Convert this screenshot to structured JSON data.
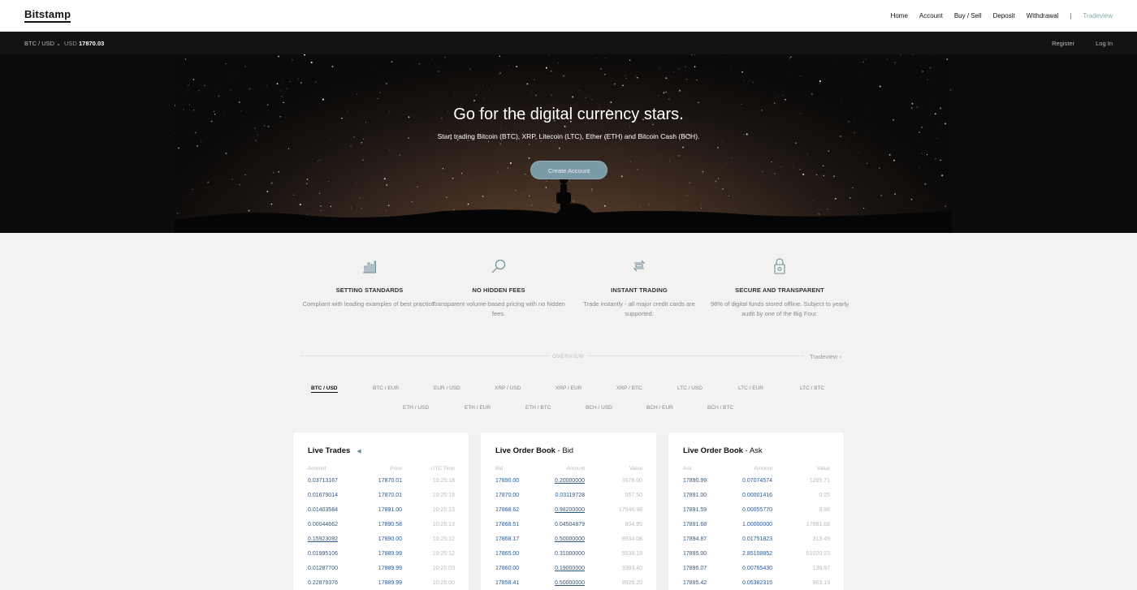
{
  "nav": {
    "logo": "Bitstamp",
    "items": [
      "Home",
      "Account",
      "Buy / Sell",
      "Deposit",
      "Withdrawal"
    ],
    "separator": "|",
    "tradeview": "Tradeview"
  },
  "ticker": {
    "pair": "BTC / USD",
    "currency": "USD",
    "price": "17870.03",
    "register": "Register",
    "login": "Log In"
  },
  "hero": {
    "title": "Go for the digital currency stars.",
    "subtitle": "Start trading Bitcoin (BTC), XRP, Litecoin (LTC), Ether (ETH) and Bitcoin Cash (BCH).",
    "cta": "Create Account"
  },
  "features": [
    {
      "icon": "bar-chart-icon",
      "title": "SETTING STANDARDS",
      "desc": "Compliant with leading examples of best practice."
    },
    {
      "icon": "magnifier-icon",
      "title": "NO HIDDEN FEES",
      "desc": "Transparent volume-based pricing with no hidden fees."
    },
    {
      "icon": "exchange-icon",
      "title": "INSTANT TRADING",
      "desc": "Trade instantly - all major credit cards are supported."
    },
    {
      "icon": "lock-icon",
      "title": "SECURE AND TRANSPARENT",
      "desc": "98% of digital funds stored offline. Subject to yearly audit by one of the Big Four."
    }
  ],
  "overview": {
    "label": "OVERVIEW",
    "tradeview_link": "Tradeview ›",
    "pairs_row1": [
      "BTC / USD",
      "BTC / EUR",
      "EUR / USD",
      "XRP / USD",
      "XRP / EUR",
      "XRP / BTC",
      "LTC / USD",
      "LTC / EUR",
      "LTC / BTC"
    ],
    "pairs_row2": [
      "ETH / USD",
      "ETH / EUR",
      "ETH / BTC",
      "BCH / USD",
      "BCH / EUR",
      "BCH / BTC"
    ],
    "active_pair": "BTC / USD"
  },
  "live_trades": {
    "title": "Live Trades",
    "headers": [
      "Amount",
      "Price",
      "UTC Time"
    ],
    "rows": [
      [
        "0.03713167",
        "17870.01",
        "10:25:18"
      ],
      [
        "0.01679014",
        "17870.01",
        "10:25:18"
      ],
      [
        "0.01403584",
        "17891.00",
        "10:25:13"
      ],
      [
        "0.00044662",
        "17890.58",
        "10:25:13"
      ],
      [
        "0.15923092",
        "17890.00",
        "10:25:12"
      ],
      [
        "0.01995106",
        "17889.99",
        "10:25:12"
      ],
      [
        "0.01287700",
        "17889.99",
        "10:25:03"
      ],
      [
        "0.22879376",
        "17889.99",
        "10:25:00"
      ]
    ],
    "underlined_rows": [
      4
    ]
  },
  "bid_book": {
    "title_bold": "Live Order Book",
    "title_rest": " - Bid",
    "headers": [
      "Bid",
      "Amount",
      "Value"
    ],
    "rows": [
      [
        "17890.00",
        "0.20000000",
        "3578.00"
      ],
      [
        "17870.00",
        "0.03119728",
        "557.50"
      ],
      [
        "17868.62",
        "0.98200000",
        "17546.98"
      ],
      [
        "17868.51",
        "0.04504879",
        "804.95"
      ],
      [
        "17868.17",
        "0.50000000",
        "8934.08"
      ],
      [
        "17865.00",
        "0.31000000",
        "5538.15"
      ],
      [
        "17860.00",
        "0.19000000",
        "3393.40"
      ],
      [
        "17858.41",
        "0.50000000",
        "8929.20"
      ]
    ],
    "underlined_rows": [
      0,
      2,
      4,
      6,
      7
    ]
  },
  "ask_book": {
    "title_bold": "Live Order Book",
    "title_rest": " - Ask",
    "headers": [
      "Ask",
      "Amount",
      "Value"
    ],
    "rows": [
      [
        "17890.99",
        "0.07074574",
        "1265.71"
      ],
      [
        "17891.00",
        "0.00001416",
        "0.25"
      ],
      [
        "17891.59",
        "0.00055770",
        "9.98"
      ],
      [
        "17891.68",
        "1.00000000",
        "17891.68"
      ],
      [
        "17894.87",
        "0.01751823",
        "313.49"
      ],
      [
        "17895.00",
        "2.85108852",
        "51020.23"
      ],
      [
        "17895.07",
        "0.00765430",
        "136.97"
      ],
      [
        "17895.42",
        "0.05382315",
        "963.19"
      ]
    ],
    "underlined_rows": []
  }
}
